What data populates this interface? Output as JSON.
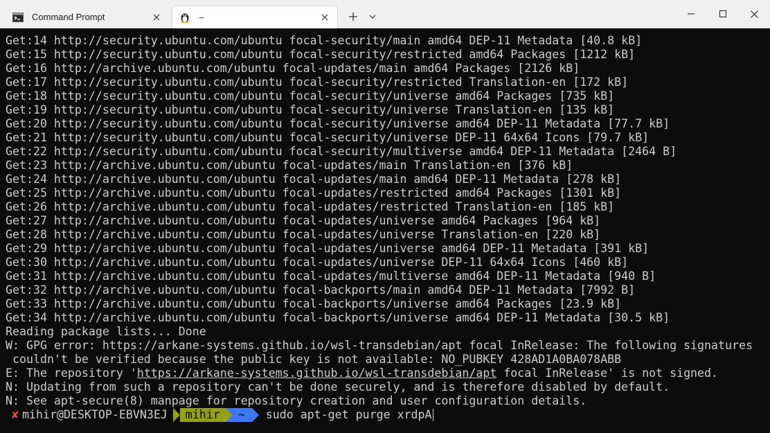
{
  "tabs": [
    {
      "label": "Command Prompt",
      "icon": "cmd-icon",
      "active": false
    },
    {
      "label": "~",
      "icon": "tux-linux-icon",
      "active": true
    }
  ],
  "window_controls": [
    "minimize",
    "maximize",
    "close"
  ],
  "terminal": {
    "lines": [
      "Get:14 http://security.ubuntu.com/ubuntu focal-security/main amd64 DEP-11 Metadata [40.8 kB]",
      "Get:15 http://security.ubuntu.com/ubuntu focal-security/restricted amd64 Packages [1212 kB]",
      "Get:16 http://archive.ubuntu.com/ubuntu focal-updates/main amd64 Packages [2126 kB]",
      "Get:17 http://security.ubuntu.com/ubuntu focal-security/restricted Translation-en [172 kB]",
      "Get:18 http://security.ubuntu.com/ubuntu focal-security/universe amd64 Packages [735 kB]",
      "Get:19 http://security.ubuntu.com/ubuntu focal-security/universe Translation-en [135 kB]",
      "Get:20 http://security.ubuntu.com/ubuntu focal-security/universe amd64 DEP-11 Metadata [77.7 kB]",
      "Get:21 http://security.ubuntu.com/ubuntu focal-security/universe DEP-11 64x64 Icons [79.7 kB]",
      "Get:22 http://security.ubuntu.com/ubuntu focal-security/multiverse amd64 DEP-11 Metadata [2464 B]",
      "Get:23 http://archive.ubuntu.com/ubuntu focal-updates/main Translation-en [376 kB]",
      "Get:24 http://archive.ubuntu.com/ubuntu focal-updates/main amd64 DEP-11 Metadata [278 kB]",
      "Get:25 http://archive.ubuntu.com/ubuntu focal-updates/restricted amd64 Packages [1301 kB]",
      "Get:26 http://archive.ubuntu.com/ubuntu focal-updates/restricted Translation-en [185 kB]",
      "Get:27 http://archive.ubuntu.com/ubuntu focal-updates/universe amd64 Packages [964 kB]",
      "Get:28 http://archive.ubuntu.com/ubuntu focal-updates/universe Translation-en [220 kB]",
      "Get:29 http://archive.ubuntu.com/ubuntu focal-updates/universe amd64 DEP-11 Metadata [391 kB]",
      "Get:30 http://archive.ubuntu.com/ubuntu focal-updates/universe DEP-11 64x64 Icons [460 kB]",
      "Get:31 http://archive.ubuntu.com/ubuntu focal-updates/multiverse amd64 DEP-11 Metadata [940 B]",
      "Get:32 http://archive.ubuntu.com/ubuntu focal-backports/main amd64 DEP-11 Metadata [7992 B]",
      "Get:33 http://archive.ubuntu.com/ubuntu focal-backports/universe amd64 Packages [23.9 kB]",
      "Get:34 http://archive.ubuntu.com/ubuntu focal-backports/universe amd64 DEP-11 Metadata [30.5 kB]",
      "Reading package lists... Done",
      "W: GPG error: https://arkane-systems.github.io/wsl-transdebian/apt focal InRelease: The following signatures",
      " couldn't be verified because the public key is not available: NO_PUBKEY 428AD1A0BA078ABB"
    ],
    "error_line": {
      "prefix": "E: The repository '",
      "link": "https://arkane-systems.github.io/wsl-transdebian/apt",
      "suffix": " focal InRelease' is not signed."
    },
    "notice_lines": [
      "N: Updating from such a repository can't be done securely, and is therefore disabled by default.",
      "N: See apt-secure(8) manpage for repository creation and user configuration details."
    ],
    "prompt": {
      "status_mark": "✘",
      "user_host": "mihir@DESKTOP-EBVN3EJ",
      "dir_segment": "mihir",
      "home_segment": "~",
      "command": "sudo apt-get purge xrdpA"
    }
  },
  "colors": {
    "background": "#0c0c0c",
    "foreground": "#cccccc",
    "error_mark": "#e74856",
    "segment_green": "#96a014",
    "segment_blue": "#3b78ff"
  }
}
